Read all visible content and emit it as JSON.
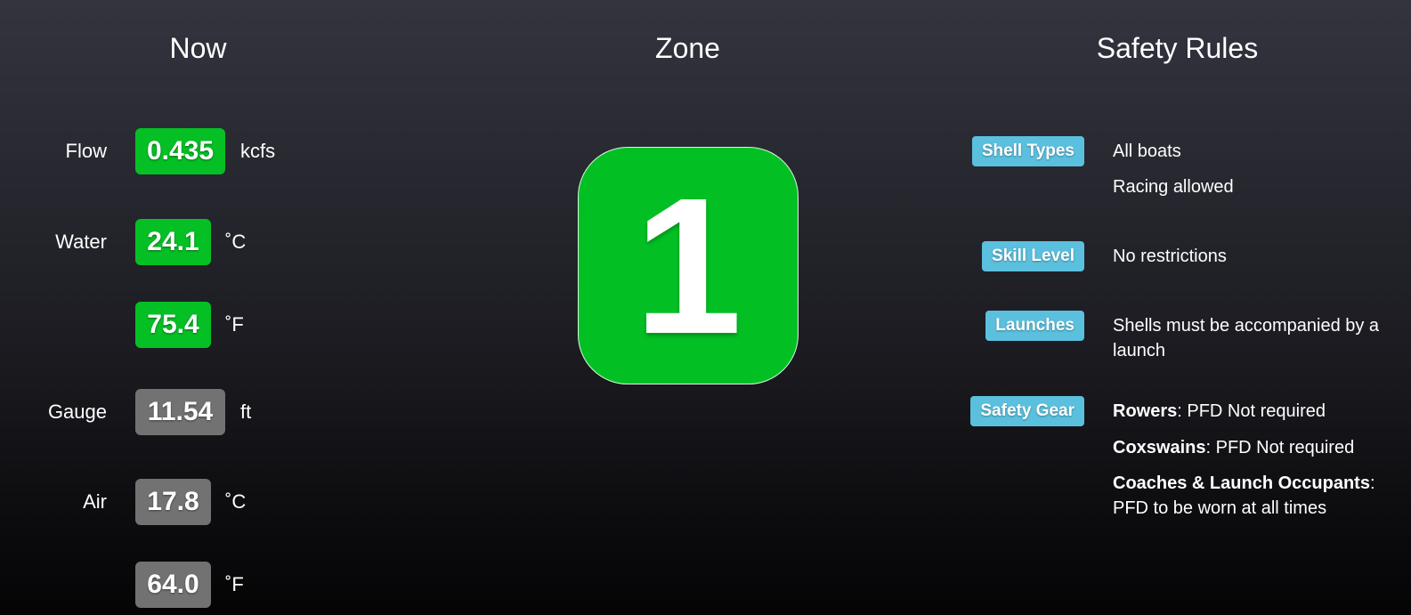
{
  "columns": {
    "now": "Now",
    "zone": "Zone",
    "safety_rules": "Safety Rules"
  },
  "now": {
    "flow": {
      "label": "Flow",
      "value": "0.435",
      "unit": "kcfs",
      "status_color": "#05c024"
    },
    "water_c": {
      "label": "Water",
      "value": "24.1",
      "unit": "˚C",
      "status_color": "#05c024"
    },
    "water_f": {
      "value": "75.4",
      "unit": "˚F",
      "status_color": "#05c024"
    },
    "gauge": {
      "label": "Gauge",
      "value": "11.54",
      "unit": "ft",
      "status_color": "#727272"
    },
    "air_c": {
      "label": "Air",
      "value": "17.8",
      "unit": "˚C",
      "status_color": "#727272"
    },
    "air_f": {
      "value": "64.0",
      "unit": "˚F",
      "status_color": "#727272"
    }
  },
  "zone": {
    "number": "1",
    "color": "#02c024"
  },
  "safety_rules": {
    "badge_color": "#5bc0de",
    "shell_types": {
      "label": "Shell Types",
      "lines": [
        "All boats",
        "Racing allowed"
      ]
    },
    "skill_level": {
      "label": "Skill Level",
      "text": "No restrictions"
    },
    "launches": {
      "label": "Launches",
      "text": "Shells must be accompanied by a launch"
    },
    "safety_gear": {
      "label": "Safety Gear",
      "rowers": {
        "who": "Rowers",
        "what": ": PFD Not required"
      },
      "coxswains": {
        "who": "Coxswains",
        "what": ": PFD Not required"
      },
      "coaches": {
        "who": "Coaches & Launch Occupants",
        "what": ": PFD to be worn at all times"
      }
    }
  }
}
